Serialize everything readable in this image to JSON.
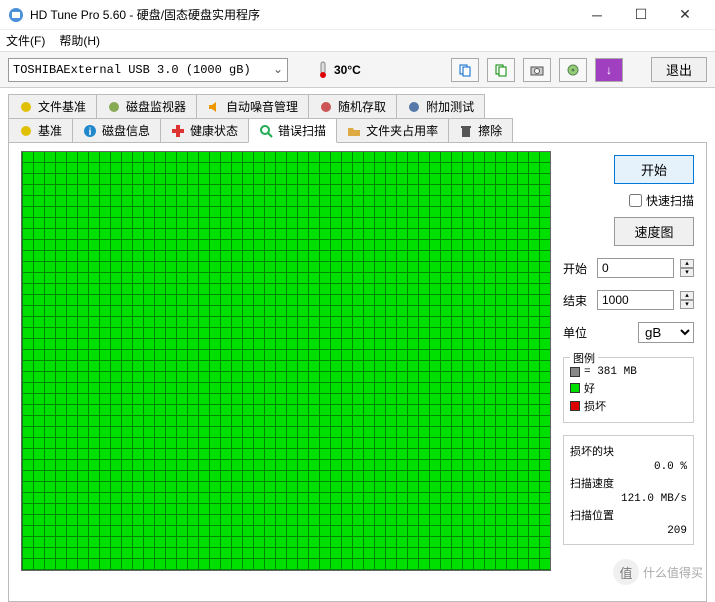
{
  "window": {
    "title": "HD Tune Pro 5.60 - 硬盘/固态硬盘实用程序"
  },
  "menu": {
    "file": "文件(F)",
    "help": "帮助(H)"
  },
  "toolbar": {
    "drive": "TOSHIBAExternal USB 3.0 (1000 gB)",
    "temp": "30°C",
    "exit": "退出"
  },
  "tabs": {
    "row1": [
      {
        "icon": "bulb-yellow",
        "label": "文件基准"
      },
      {
        "icon": "disk-monitor",
        "label": "磁盘监视器"
      },
      {
        "icon": "speaker",
        "label": "自动噪音管理"
      },
      {
        "icon": "random",
        "label": "随机存取"
      },
      {
        "icon": "extra",
        "label": "附加测试"
      }
    ],
    "row2": [
      {
        "icon": "bulb",
        "label": "基准"
      },
      {
        "icon": "info",
        "label": "磁盘信息"
      },
      {
        "icon": "health",
        "label": "健康状态"
      },
      {
        "icon": "scan",
        "label": "错误扫描",
        "active": true
      },
      {
        "icon": "folder",
        "label": "文件夹占用率"
      },
      {
        "icon": "erase",
        "label": "擦除"
      }
    ]
  },
  "panel": {
    "start_btn": "开始",
    "quick_scan": "快速扫描",
    "speed_map": "速度图",
    "start_label": "开始",
    "start_val": "0",
    "end_label": "结束",
    "end_val": "1000",
    "unit_label": "单位",
    "unit_val": "gB"
  },
  "legend": {
    "title": "图例",
    "block_size": "= 381 MB",
    "good": "好",
    "bad": "损坏"
  },
  "stats": {
    "damaged_label": "损坏的块",
    "damaged_val": "0.0 %",
    "speed_label": "扫描速度",
    "speed_val": "121.0 MB/s",
    "pos_label": "扫描位置",
    "pos_val": "209"
  },
  "watermark": {
    "char": "值",
    "text": "什么值得买"
  }
}
